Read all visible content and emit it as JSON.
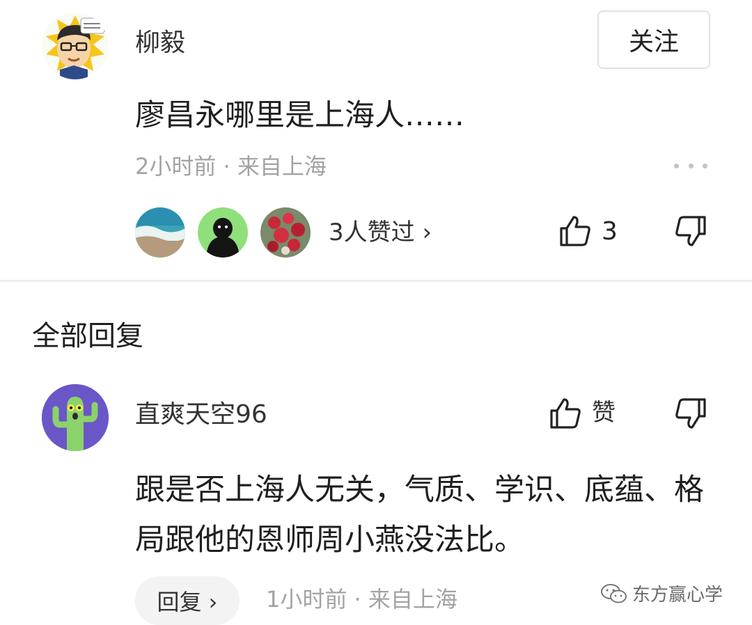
{
  "comment": {
    "username": "柳毅",
    "follow_label": "关注",
    "text": "廖昌永哪里是上海人……",
    "meta": "2小时前 · 来自上海",
    "likers_text": "3人赞过 ›",
    "like_count": "3"
  },
  "replies_section": {
    "title": "全部回复"
  },
  "reply": {
    "username": "直爽天空96",
    "like_label": "赞",
    "text": "跟是否上海人无关，气质、学识、底蕴、格局跟他的恩师周小燕没法比。",
    "reply_label": "回复 ›",
    "meta": "1小时前 · 来自上海"
  },
  "watermark": {
    "text": "东方赢心学"
  },
  "icons": {
    "like": "thumbs-up-icon",
    "dislike": "thumbs-down-icon",
    "more": "more-dots-icon"
  },
  "colors": {
    "meta_gray": "#a3a3a3",
    "divider": "#eeeeee",
    "reply_avatar_bg": "#6b56c8"
  }
}
